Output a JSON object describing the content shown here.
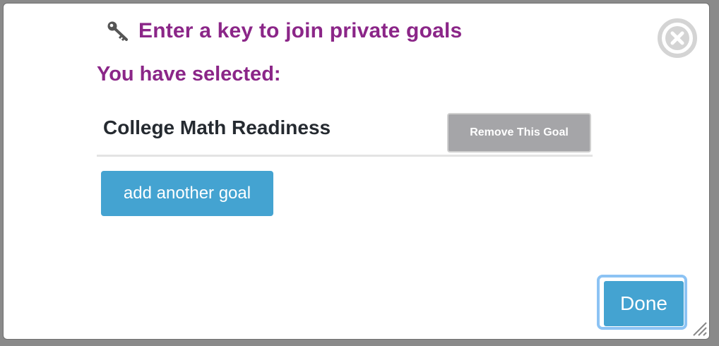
{
  "dialog": {
    "key_link_label": "Enter a key to join private goals",
    "heading": "You have selected:",
    "selected_goals": [
      {
        "name": "College Math Readiness",
        "remove_label": "Remove This Goal"
      }
    ],
    "add_goal_label": "add another goal",
    "done_label": "Done"
  },
  "icons": {
    "key": "key-icon",
    "close": "close-icon",
    "resize": "resize-grip-icon"
  },
  "colors": {
    "heading_purple": "#8b2688",
    "button_blue": "#44a3d1",
    "remove_gray": "#a5a5a8",
    "done_focus_ring": "#8cc3f4"
  }
}
